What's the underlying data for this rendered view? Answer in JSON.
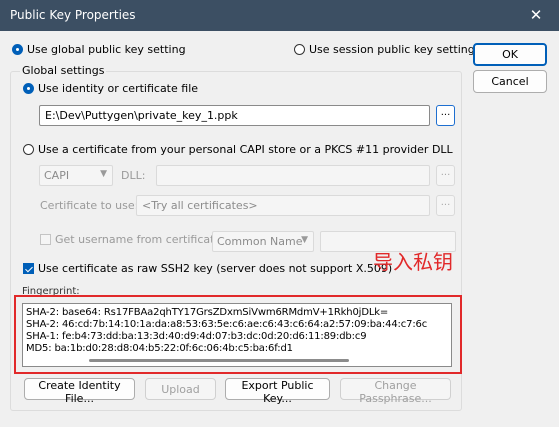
{
  "window": {
    "title": "Public Key Properties",
    "close_glyph": "✕"
  },
  "scope": {
    "global_label": "Use global public key setting",
    "session_label": "Use session public key setting",
    "selected": "global"
  },
  "buttons": {
    "ok": "OK",
    "cancel": "Cancel"
  },
  "global_settings": {
    "label": "Global settings",
    "use_file_label": "Use identity or certificate file",
    "file_path": "E:\\Dev\\Puttygen\\private_key_1.ppk",
    "browse_label": "...",
    "use_store_label": "Use a certificate from your personal CAPI store or a PKCS #11 provider DLL",
    "provider_value": "CAPI",
    "dll_label": "DLL:",
    "dll_browse_label": "...",
    "cert_to_use_label": "Certificate to use:",
    "cert_to_use_value": "<Try all certificates>",
    "cert_browse_label": "...",
    "get_username_label": "Get username from certificate:",
    "username_source_value": "Common Name",
    "raw_ssh2_label": "Use certificate as raw SSH2 key (server does not support X.509)",
    "raw_ssh2_checked": true
  },
  "fingerprint": {
    "label": "Fingerprint:",
    "lines": [
      "SHA-2: base64: Rs17FBAa2qhTY17GrsZDxmSiVwm6RMdmV+1Rkh0jDLk=",
      "SHA-2: 46:cd:7b:14:10:1a:da:a8:53:63:5e:c6:ae:c6:43:c6:64:a2:57:09:ba:44:c7:6c",
      "SHA-1: fe:b4:73:dd:ba:13:3d:40:d9:4d:07:b3:dc:0d:20:d6:11:89:db:c9",
      "MD5: ba:1b:d0:28:d8:04:b5:22:0f:6c:06:4b:c5:ba:6f:d1"
    ]
  },
  "bottom_buttons": {
    "create_identity": "Create Identity File...",
    "upload": "Upload",
    "export_public": "Export Public Key...",
    "change_passphrase": "Change Passphrase..."
  },
  "annotation": {
    "text": "导入私钥"
  },
  "colors": {
    "accent": "#005fb8",
    "highlight": "#e1292a",
    "titlebar": "#3c4f63"
  }
}
